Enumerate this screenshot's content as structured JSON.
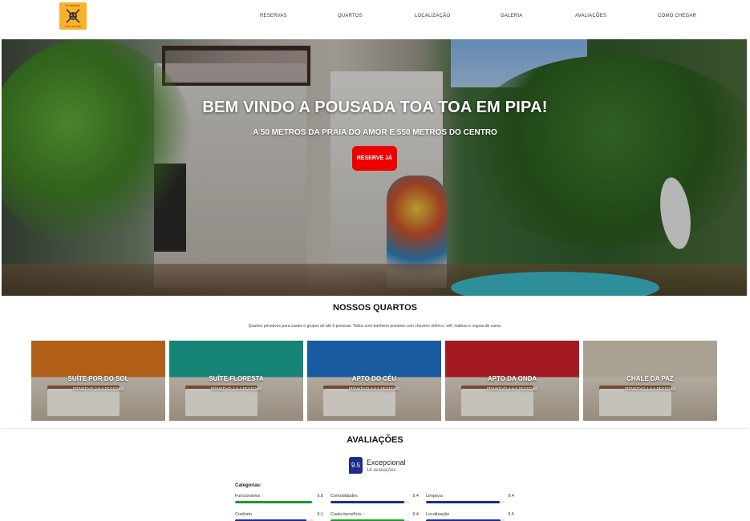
{
  "header": {
    "logo": {
      "top_text": "BY PROPRIO",
      "bottom_text": "TOA TOA PIPA",
      "icon": "crossed-swords-mask-icon"
    },
    "nav": [
      "RESERVAS",
      "QUARTOS",
      "LOCALIZAÇÃO",
      "GALERIA",
      "AVALIAÇÕES",
      "COMO CHEGAR"
    ]
  },
  "hero": {
    "title": "BEM VINDO A POUSADA TOA TOA EM PIPA!",
    "subtitle": "A 50 METROS DA PRAIA DO AMOR E 550 METROS DO CENTRO",
    "button": "RESERVE JÁ"
  },
  "rooms": {
    "title": "NOSSOS QUARTOS",
    "description": "Quartos privativos para casais e grupos de até 6 pessoas. Todos com banheiro privativo com chuveiro elétrico, wifi, toalhas e roupas de cama.",
    "items": [
      {
        "name": "SUÍTE POR DO SOL",
        "capacity": "PRIVATIVO 2 A 4 PESSOAS",
        "wall_color": "#d9741f"
      },
      {
        "name": "SUÍTE FLORESTA",
        "capacity": "PRIVATIVO 2 A 4 PESSOAS",
        "wall_color": "#1aa190"
      },
      {
        "name": "APTO DO CÉU",
        "capacity": "PRIVATIVO 4 A 6 PESSOAS",
        "wall_color": "#1f6fc4"
      },
      {
        "name": "APTO DA ONDA",
        "capacity": "PRIVATIVO 4 A 6 PESSOAS",
        "wall_color": "#c9202a"
      },
      {
        "name": "CHALE DA PAZ",
        "capacity": "PRIVATIVO 1 A 3 PESSOAS",
        "wall_color": "#cfc6b3"
      }
    ]
  },
  "reviews": {
    "title": "AVALIAÇÕES",
    "score": "9.5",
    "score_label": "Excepcional",
    "count": "16 avaliações",
    "categories_title": "Categorias:",
    "categories": [
      {
        "name": "Funcionários",
        "value": "9.8",
        "arrow": true,
        "fill": 0.98,
        "color": "#1a9b2e"
      },
      {
        "name": "Comodidades",
        "value": "9.4",
        "arrow": false,
        "fill": 0.94,
        "color": "#1d2d8b"
      },
      {
        "name": "Limpeza",
        "value": "9.4",
        "arrow": false,
        "fill": 0.94,
        "color": "#1d2d8b"
      },
      {
        "name": "Conforto",
        "value": "9.1",
        "arrow": false,
        "fill": 0.91,
        "color": "#1d2d8b"
      },
      {
        "name": "Custo-benefício",
        "value": "9.4",
        "arrow": true,
        "fill": 0.94,
        "color": "#1a9b2e"
      },
      {
        "name": "Localização",
        "value": "9.5",
        "arrow": false,
        "fill": 0.95,
        "color": "#1d2d8b"
      }
    ]
  }
}
